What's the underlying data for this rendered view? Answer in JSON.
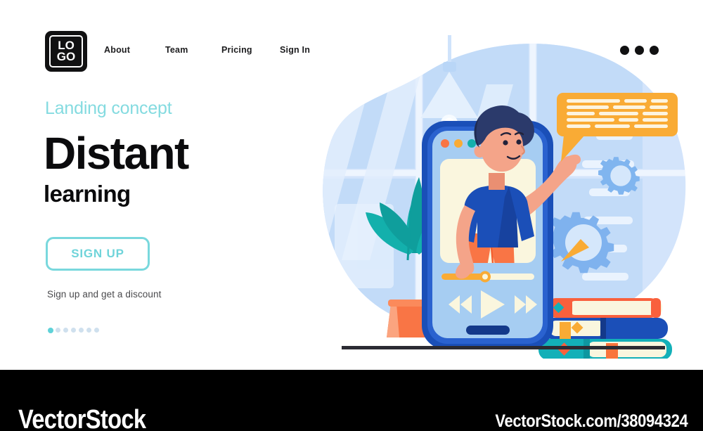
{
  "brand": {
    "logo_top": "LO",
    "logo_bottom": "GO"
  },
  "nav": {
    "items": [
      {
        "label": "About"
      },
      {
        "label": "Team"
      },
      {
        "label": "Pricing"
      },
      {
        "label": "Sign In"
      }
    ],
    "menu_icon": "kebab-menu-icon"
  },
  "hero": {
    "eyebrow": "Landing concept",
    "title_line1": "Distant",
    "title_line2": "learning",
    "cta_label": "SIGN UP",
    "cta_sub": "Sign up and get a discount",
    "pagination": {
      "total": 7,
      "active_index": 0
    }
  },
  "illustration": {
    "name": "distant-learning-illustration",
    "blob_color": "#cde2fa",
    "window_color": "#bfd9f7",
    "phone_frame_color": "#1a4fb8",
    "phone_screen_color": "#a6cdf2",
    "video_bg_color": "#faf6de",
    "shirt_color": "#1b4fb8",
    "pants_color": "#f97545",
    "hair_color": "#2b3a6b",
    "skin_color": "#f4a489",
    "bubble_color": "#f9ab35",
    "gear_color": "#7fb4ee",
    "plant_leaf_color": "#13b0ac",
    "plant_pot_color": "#f97545",
    "book_top_color": "#f9603c",
    "book_mid_color": "#1b4fb8",
    "book_bottom_color": "#13b0b8",
    "dot_colors": [
      "#f97545",
      "#f9ab35",
      "#13b0ac"
    ],
    "progress_color": "#f9ab35",
    "ground_color": "#2b2b33",
    "controls": [
      "rewind-icon",
      "play-icon",
      "fast-forward-icon"
    ]
  },
  "footer": {
    "brand": "VectorStock",
    "url": "VectorStock.com/38094324"
  }
}
